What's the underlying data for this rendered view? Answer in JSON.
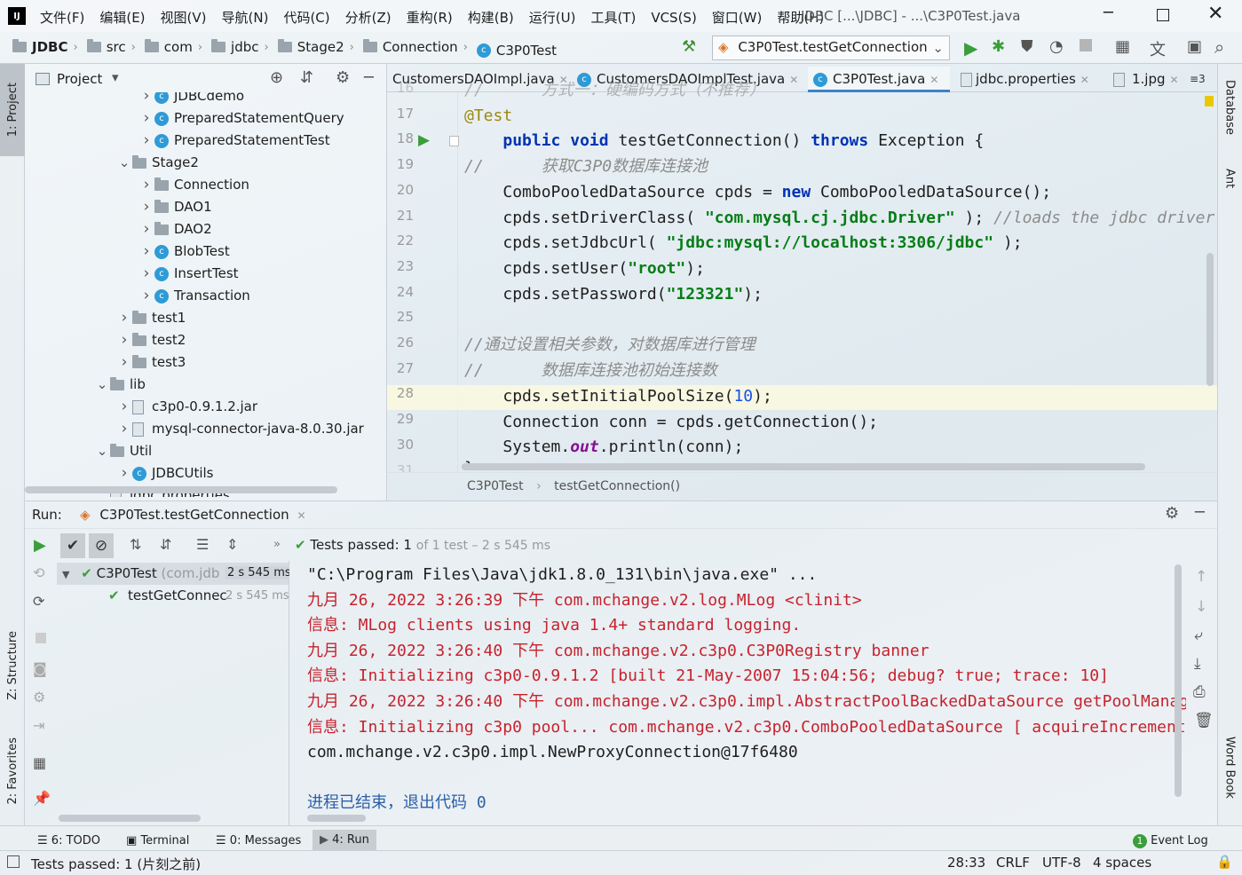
{
  "menubar": {
    "items": [
      "文件(F)",
      "编辑(E)",
      "视图(V)",
      "导航(N)",
      "代码(C)",
      "分析(Z)",
      "重构(R)",
      "构建(B)",
      "运行(U)",
      "工具(T)",
      "VCS(S)",
      "窗口(W)",
      "帮助(H)"
    ],
    "title": "JDBC [...\\JDBC] - ...\\C3P0Test.java"
  },
  "breadcrumb": [
    "JDBC",
    "src",
    "com",
    "jdbc",
    "Stage2",
    "Connection",
    "C3P0Test"
  ],
  "run_config": "C3P0Test.testGetConnection",
  "project_panel": {
    "title": "Project",
    "tree": [
      {
        "label": "JDBCdemo",
        "type": "class"
      },
      {
        "label": "PreparedStatementQuery",
        "type": "class"
      },
      {
        "label": "PreparedStatementTest",
        "type": "class"
      },
      {
        "label": "Stage2",
        "type": "folder"
      },
      {
        "label": "Connection",
        "type": "folder"
      },
      {
        "label": "DAO1",
        "type": "folder"
      },
      {
        "label": "DAO2",
        "type": "folder"
      },
      {
        "label": "BlobTest",
        "type": "class"
      },
      {
        "label": "InsertTest",
        "type": "class"
      },
      {
        "label": "Transaction",
        "type": "class"
      },
      {
        "label": "test1",
        "type": "folder"
      },
      {
        "label": "test2",
        "type": "folder"
      },
      {
        "label": "test3",
        "type": "folder"
      },
      {
        "label": "lib",
        "type": "folder"
      },
      {
        "label": "c3p0-0.9.1.2.jar",
        "type": "jar"
      },
      {
        "label": "mysql-connector-java-8.0.30.jar",
        "type": "jar"
      },
      {
        "label": "Util",
        "type": "folder"
      },
      {
        "label": "JDBCUtils",
        "type": "class"
      },
      {
        "label": "jdbc.properties",
        "type": "file"
      }
    ]
  },
  "editor_tabs": [
    {
      "label": "CustomersDAOImpl.java",
      "active": false
    },
    {
      "label": "CustomersDAOImplTest.java",
      "active": false
    },
    {
      "label": "C3P0Test.java",
      "active": true
    },
    {
      "label": "jdbc.properties",
      "active": false
    },
    {
      "label": "1.jpg",
      "active": false
    }
  ],
  "tab_overflow": "≡3",
  "line_numbers": [
    "16",
    "17",
    "18",
    "19",
    "20",
    "21",
    "22",
    "23",
    "24",
    "25",
    "26",
    "27",
    "28",
    "29",
    "30",
    "31"
  ],
  "code": {
    "l16": "//      方式一：硬编码方式（不推荐）",
    "l17_ann": "@Test",
    "l18_kw1": "public",
    "l18_kw2": "void",
    "l18_name": "testGetConnection()",
    "l18_throws": "throws",
    "l18_rest": "Exception {",
    "l19": "//      获取C3P0数据库连接池",
    "l20_a": "ComboPooledDataSource cpds = ",
    "l20_new": "new",
    "l20_b": " ComboPooledDataSource();",
    "l21_a": "cpds.setDriverClass( ",
    "l21_str": "\"com.mysql.cj.jdbc.Driver\"",
    "l21_b": " ); ",
    "l21_cmt": "//loads the jdbc driver",
    "l22_a": "cpds.setJdbcUrl( ",
    "l22_str": "\"jdbc:mysql://localhost:3306/jdbc\"",
    "l22_b": " );",
    "l23_a": "cpds.setUser(",
    "l23_str": "\"root\"",
    "l23_b": ");",
    "l24_a": "cpds.setPassword(",
    "l24_str": "\"123321\"",
    "l24_b": ");",
    "l26": "//通过设置相关参数，对数据库进行管理",
    "l27": "//      数据库连接池初始连接数",
    "l28_a": "cpds.setInitialPoolSize(",
    "l28_num": "10",
    "l28_b": ");",
    "l29": "Connection conn = cpds.getConnection();",
    "l30_a": "System.",
    "l30_fld": "out",
    "l30_b": ".println(conn);",
    "l31": "}"
  },
  "editor_breadcrumb": [
    "C3P0Test",
    "testGetConnection()"
  ],
  "run_panel": {
    "label": "Run:",
    "tab": "C3P0Test.testGetConnection",
    "status_pass": "Tests passed:",
    "status_count": "1",
    "status_rest": "of 1 test – 2 s 545 ms",
    "tree": [
      {
        "label": "C3P0Test",
        "sub": "(com.jdb",
        "time": "2 s 545 ms"
      },
      {
        "label": "testGetConnec",
        "time": "2 s 545 ms"
      }
    ],
    "output": [
      {
        "text": "\"C:\\Program Files\\Java\\jdk1.8.0_131\\bin\\java.exe\" ...",
        "color": "black"
      },
      {
        "text": "九月 26, 2022 3:26:39 下午 com.mchange.v2.log.MLog <clinit>",
        "color": "red"
      },
      {
        "text": "信息: MLog clients using java 1.4+ standard logging.",
        "color": "red"
      },
      {
        "text": "九月 26, 2022 3:26:40 下午 com.mchange.v2.c3p0.C3P0Registry banner",
        "color": "red"
      },
      {
        "text": "信息: Initializing c3p0-0.9.1.2 [built 21-May-2007 15:04:56; debug? true; trace: 10]",
        "color": "red"
      },
      {
        "text": "九月 26, 2022 3:26:40 下午 com.mchange.v2.c3p0.impl.AbstractPoolBackedDataSource getPoolManager",
        "color": "red"
      },
      {
        "text": "信息: Initializing c3p0 pool... com.mchange.v2.c3p0.ComboPooledDataSource [ acquireIncrement",
        "color": "red"
      },
      {
        "text": "com.mchange.v2.c3p0.impl.NewProxyConnection@17f6480",
        "color": "black"
      },
      {
        "text": "",
        "color": "black"
      },
      {
        "text": "进程已结束，退出代码 0",
        "color": "blue"
      }
    ]
  },
  "left_strip": {
    "project": "1: Project",
    "structure": "Z: Structure",
    "favorites": "2: Favorites"
  },
  "right_strip": {
    "database": "Database",
    "ant": "Ant",
    "wordbook": "Word Book"
  },
  "bottom_tools": [
    {
      "label": "6: TODO"
    },
    {
      "label": "Terminal"
    },
    {
      "label": "0: Messages"
    },
    {
      "label": "4: Run"
    }
  ],
  "event_log": {
    "badge": "1",
    "label": "Event Log"
  },
  "statusbar": {
    "message": "Tests passed: 1 (片刻之前)",
    "position": "28:33",
    "line_sep": "CRLF",
    "encoding": "UTF-8",
    "indent": "4 spaces"
  }
}
